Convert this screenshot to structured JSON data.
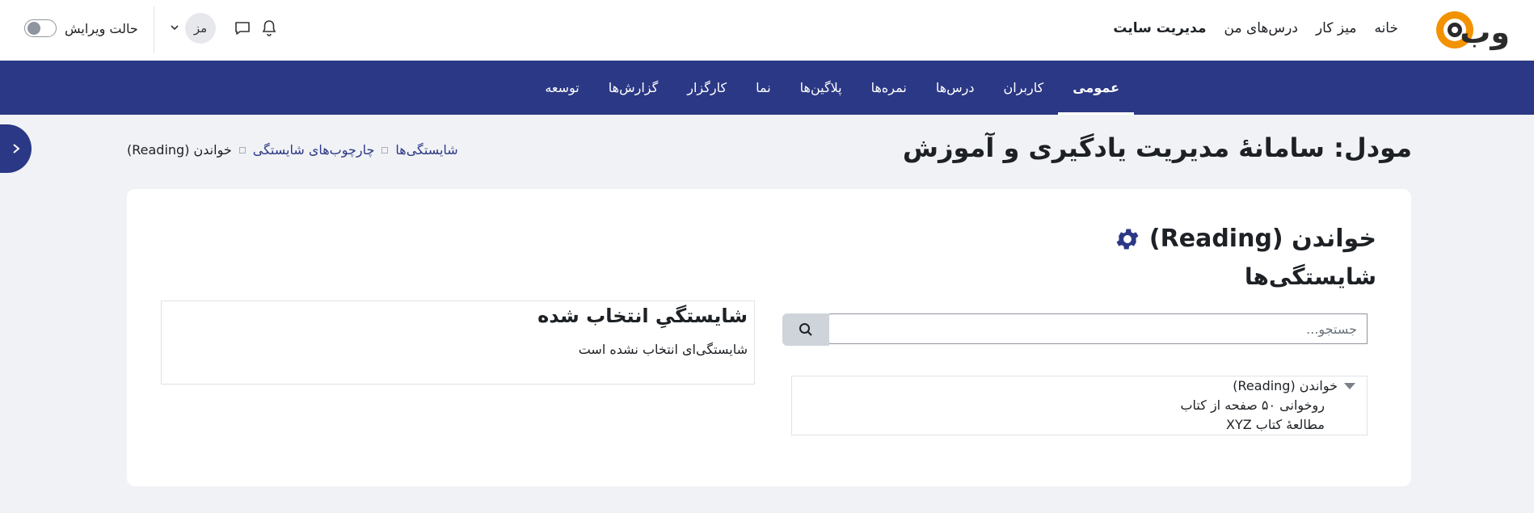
{
  "brand": {
    "logo_text": "وب"
  },
  "topnav": {
    "items": [
      {
        "label": "خانه"
      },
      {
        "label": "میز کار"
      },
      {
        "label": "درس‌های من"
      },
      {
        "label": "مدیریت سایت"
      }
    ]
  },
  "user": {
    "edit_mode_label": "حالت ویرایش",
    "avatar_initials": "مز"
  },
  "secnav": {
    "items": [
      {
        "label": "عمومی",
        "active": true
      },
      {
        "label": "کاربران"
      },
      {
        "label": "درس‌ها"
      },
      {
        "label": "نمره‌ها"
      },
      {
        "label": "پلاگین‌ها"
      },
      {
        "label": "نما"
      },
      {
        "label": "کارگزار"
      },
      {
        "label": "گزارش‌ها"
      },
      {
        "label": "توسعه"
      }
    ]
  },
  "page": {
    "title": "مودل: سامانهٔ مدیریت یادگیری و آموزش",
    "breadcrumb": [
      {
        "label": "شایستگی‌ها"
      },
      {
        "label": "چارچوب‌های شایستگی"
      },
      {
        "label": "خواندن (Reading)"
      }
    ]
  },
  "framework": {
    "title": "خواندن (Reading)",
    "subtitle": "شایستگی‌ها"
  },
  "search": {
    "placeholder": "جستجو..."
  },
  "tree": {
    "root": "خواندن (Reading)",
    "children": [
      {
        "label": "روخوانی ۵۰ صفحه از کتاب"
      },
      {
        "label": "مطالعهٔ کتاب XYZ"
      }
    ]
  },
  "selected": {
    "title": "شایستگیِ انتخاب شده",
    "empty_message": "شایستگی‌ای انتخاب نشده است"
  },
  "colors": {
    "primary": "#2b3885",
    "accent": "#f39200",
    "background": "#f1f2f5"
  }
}
